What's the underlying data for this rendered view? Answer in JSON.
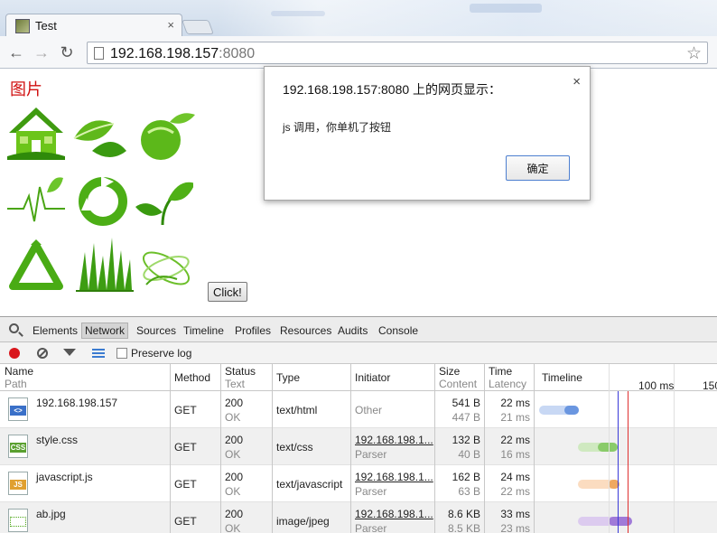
{
  "tab": {
    "title": "Test",
    "close": "×"
  },
  "toolbar": {
    "back": "←",
    "forward": "→",
    "reload": "↻",
    "url_host": "192.168.198.157",
    "url_port": ":8080",
    "star": "☆"
  },
  "page": {
    "heading": "图片",
    "button": "Click!",
    "images": [
      "house-icon",
      "leaves-icon",
      "leaf-ball-icon",
      "heartbeat-leaf-icon",
      "recycle-circle-icon",
      "sprout-icon",
      "recycle-triangle-icon",
      "grass-icon",
      "orbit-leaf-icon"
    ]
  },
  "dialog": {
    "title": "192.168.198.157:8080 上的网页显示：",
    "message": "js 调用，你单机了按钮",
    "ok": "确定",
    "close": "×"
  },
  "devtools": {
    "tabs": [
      "Elements",
      "Network",
      "Sources",
      "Timeline",
      "Profiles",
      "Resources",
      "Audits",
      "Console"
    ],
    "active_tab": "Network",
    "preserve_log": "Preserve log",
    "columns": {
      "name": "Name",
      "path": "Path",
      "method": "Method",
      "status": "Status",
      "text": "Text",
      "type": "Type",
      "initiator": "Initiator",
      "size": "Size",
      "content": "Content",
      "time": "Time",
      "latency": "Latency",
      "timeline": "Timeline",
      "tick1": "100 ms",
      "tick2": "150"
    },
    "rows": [
      {
        "name": "192.168.198.157",
        "method": "GET",
        "status": "200",
        "status_text": "OK",
        "type": "text/html",
        "initiator": "Other",
        "initiator2": "",
        "size": "541 B",
        "content": "447 B",
        "time": "22 ms",
        "latency": "21 ms"
      },
      {
        "name": "style.css",
        "method": "GET",
        "status": "200",
        "status_text": "OK",
        "type": "text/css",
        "initiator": "192.168.198.1...",
        "initiator2": "Parser",
        "size": "132 B",
        "content": "40 B",
        "time": "22 ms",
        "latency": "16 ms"
      },
      {
        "name": "javascript.js",
        "method": "GET",
        "status": "200",
        "status_text": "OK",
        "type": "text/javascript",
        "initiator": "192.168.198.1...",
        "initiator2": "Parser",
        "size": "162 B",
        "content": "63 B",
        "time": "24 ms",
        "latency": "22 ms"
      },
      {
        "name": "ab.jpg",
        "method": "GET",
        "status": "200",
        "status_text": "OK",
        "type": "image/jpeg",
        "initiator": "192.168.198.1...",
        "initiator2": "Parser",
        "size": "8.6 KB",
        "content": "8.5 KB",
        "time": "33 ms",
        "latency": "23 ms"
      }
    ],
    "file_icons": [
      "<>",
      "CSS",
      "JS",
      ""
    ]
  }
}
